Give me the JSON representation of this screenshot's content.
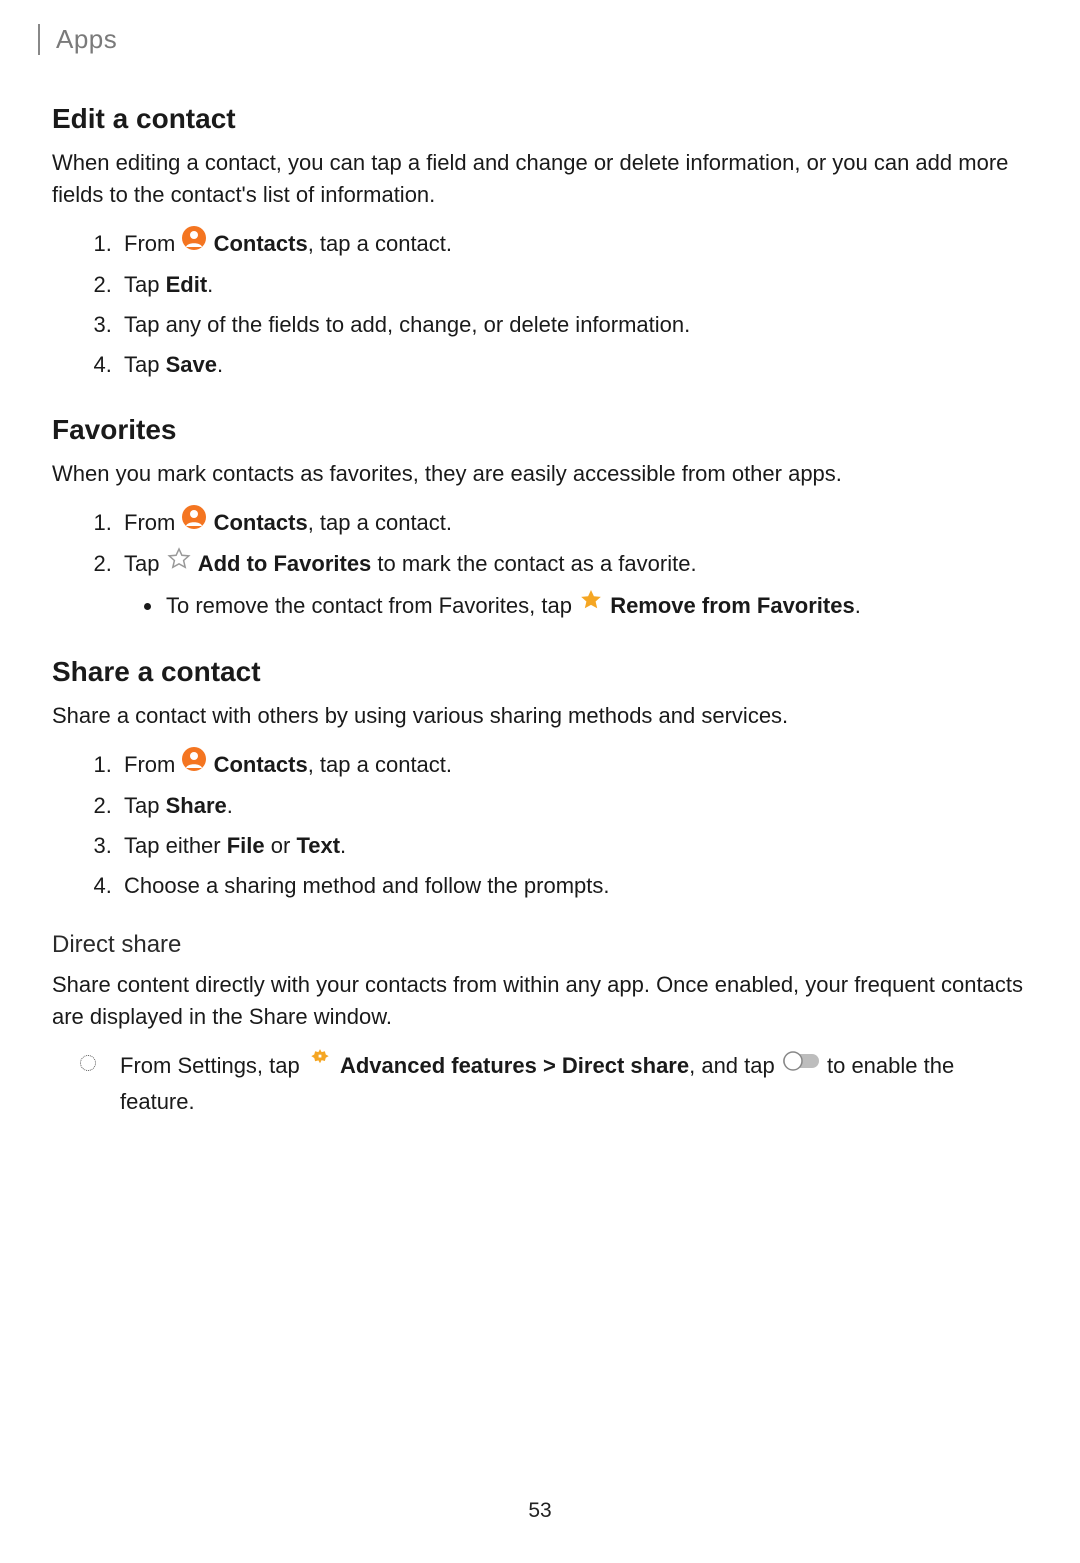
{
  "header": {
    "breadcrumb": "Apps"
  },
  "icons": {
    "contacts_alt": "Contacts icon",
    "star_outline_alt": "Star outline",
    "star_filled_alt": "Star filled",
    "gear_alt": "Advanced features gear",
    "toggle_alt": "Toggle switch"
  },
  "s1": {
    "title": "Edit a contact",
    "intro": "When editing a contact, you can tap a field and change or delete information, or you can add more fields to the contact's list of information.",
    "i1a": "From ",
    "i1b": "Contacts",
    "i1c": ", tap a contact.",
    "i2a": "Tap ",
    "i2b": "Edit",
    "i2c": ".",
    "i3": "Tap any of the fields to add, change, or delete information.",
    "i4a": "Tap ",
    "i4b": "Save",
    "i4c": "."
  },
  "s2": {
    "title": "Favorites",
    "intro": "When you mark contacts as favorites, they are easily accessible from other apps.",
    "i1a": "From ",
    "i1b": "Contacts",
    "i1c": ", tap a contact.",
    "i2a": "Tap ",
    "i2b": "Add to Favorites",
    "i2c": " to mark the contact as a favorite.",
    "sub1a": "To remove the contact from Favorites, tap ",
    "sub1b": "Remove from Favorites",
    "sub1c": "."
  },
  "s3": {
    "title": "Share a contact",
    "intro": "Share a contact with others by using various sharing methods and services.",
    "i1a": "From ",
    "i1b": "Contacts",
    "i1c": ", tap a contact.",
    "i2a": "Tap ",
    "i2b": "Share",
    "i2c": ".",
    "i3a": "Tap either ",
    "i3b": "File",
    "i3c": " or ",
    "i3d": "Text",
    "i3e": ".",
    "i4": "Choose a sharing method and follow the prompts."
  },
  "s4": {
    "title": "Direct share",
    "intro": "Share content directly with your contacts from within any app. Once enabled, your frequent contacts are displayed in the Share window.",
    "i1a": "From Settings, tap ",
    "i1b": "Advanced features",
    "i1c": " > ",
    "i1d": "Direct share",
    "i1e": ", and tap ",
    "i1f": " to enable the feature."
  },
  "page_number": "53"
}
